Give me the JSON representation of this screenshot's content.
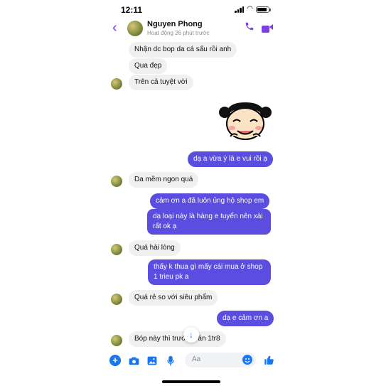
{
  "status_bar": {
    "time": "12:11",
    "battery_level": 0.85
  },
  "header": {
    "contact_name": "Nguyen Phong",
    "contact_status": "Hoạt động 26 phút trước",
    "icons": [
      "back-chevron-icon",
      "phone-icon",
      "video-call-icon"
    ]
  },
  "messages": [
    {
      "side": "in",
      "text": "Nhận dc bop da cá sấu rồi anh"
    },
    {
      "side": "in",
      "text": "Qua đẹp"
    },
    {
      "side": "in",
      "text": "Trên cả tuyệt vời"
    },
    {
      "side": "out",
      "type": "sticker",
      "sticker": "laughing-girl-sticker"
    },
    {
      "side": "out",
      "text": "dạ a vừa ý là e vui rồi ạ"
    },
    {
      "side": "in",
      "text": "Da mềm ngon quá"
    },
    {
      "side": "out",
      "text": "cảm ơn a đã luôn ủng hộ shop em"
    },
    {
      "side": "out",
      "text": "dạ loại này là hàng e tuyển nên xài rất ok ạ"
    },
    {
      "side": "in",
      "text": "Quá hài lòng"
    },
    {
      "side": "out",
      "text": "thấy k thua gì mấy cái mua ở shop 1 trieu pk a"
    },
    {
      "side": "in",
      "text": "Quá rẻ so với siêu phẩm"
    },
    {
      "side": "out",
      "text": "dạ e cảm ơn a"
    },
    {
      "side": "in",
      "text": "Bóp này thì trướ      án 1tr8"
    }
  ],
  "composer": {
    "placeholder": "Aa",
    "icons": [
      "plus-icon",
      "camera-icon",
      "gallery-icon",
      "microphone-icon",
      "emoji-icon",
      "thumbs-up-icon"
    ]
  },
  "colors": {
    "accent": "#7b3fe4",
    "outgoing_bubble": "#5b4de0",
    "incoming_bubble": "#f0f0f0",
    "composer_icon": "#1877f2"
  }
}
